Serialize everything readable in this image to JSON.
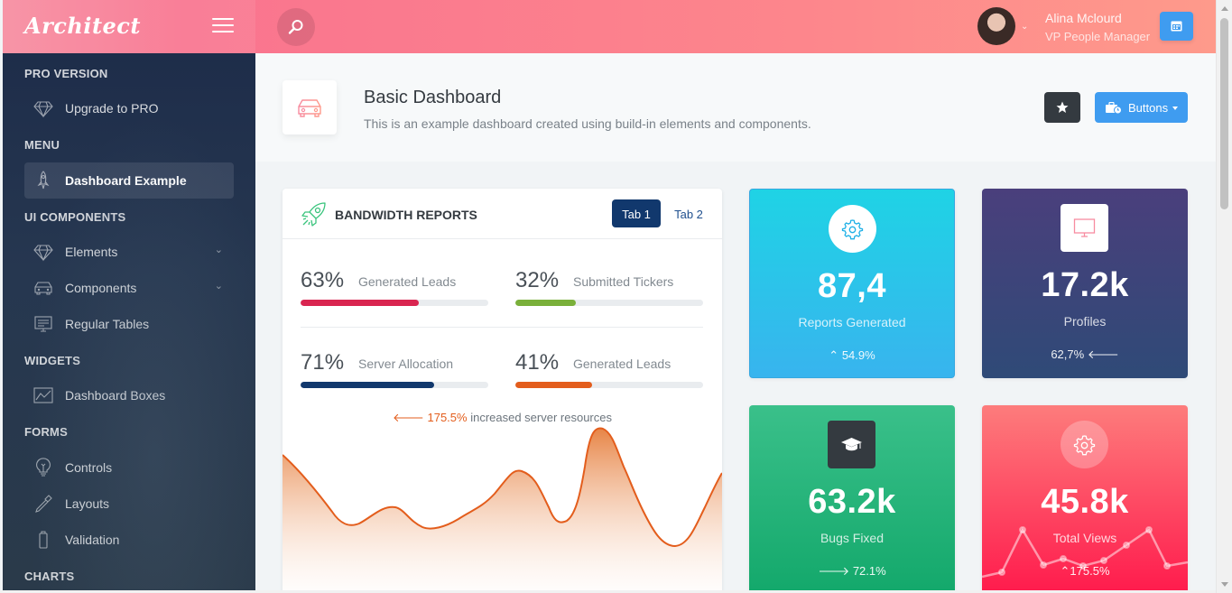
{
  "header": {
    "logo": "Architect",
    "user_name": "Alina Mclourd",
    "user_role": "VP People Manager"
  },
  "sidebar": {
    "sections": [
      {
        "heading": "PRO VERSION",
        "items": [
          {
            "label": "Upgrade to PRO",
            "icon": "diamond-icon"
          }
        ]
      },
      {
        "heading": "MENU",
        "items": [
          {
            "label": "Dashboard Example",
            "icon": "rocket-icon",
            "active": true
          }
        ]
      },
      {
        "heading": "UI COMPONENTS",
        "items": [
          {
            "label": "Elements",
            "icon": "diamond-icon",
            "expandable": true
          },
          {
            "label": "Components",
            "icon": "car-icon",
            "expandable": true
          },
          {
            "label": "Regular Tables",
            "icon": "display-icon"
          }
        ]
      },
      {
        "heading": "WIDGETS",
        "items": [
          {
            "label": "Dashboard Boxes",
            "icon": "graph-icon"
          }
        ]
      },
      {
        "heading": "FORMS",
        "items": [
          {
            "label": "Controls",
            "icon": "light-bulb-icon"
          },
          {
            "label": "Layouts",
            "icon": "eyedropper-icon"
          },
          {
            "label": "Validation",
            "icon": "battery-icon"
          }
        ]
      },
      {
        "heading": "CHARTS",
        "items": []
      }
    ]
  },
  "page_title": {
    "title": "Basic Dashboard",
    "subtitle": "This is an example dashboard created using build-in elements and components.",
    "buttons_label": "Buttons"
  },
  "bandwidth": {
    "title": "BANDWIDTH REPORTS",
    "tabs": [
      "Tab 1",
      "Tab 2"
    ],
    "progress": [
      {
        "pct": "63%",
        "label": "Generated Leads",
        "value": 63,
        "color": "#d92550"
      },
      {
        "pct": "32%",
        "label": "Submitted Tickers",
        "value": 32,
        "color": "#7ab03a"
      },
      {
        "pct": "71%",
        "label": "Server Allocation",
        "value": 71,
        "color": "#11386d"
      },
      {
        "pct": "41%",
        "label": "Generated Leads",
        "value": 41,
        "color": "#e35d1c"
      }
    ],
    "note_value": "175.5%",
    "note_text": "increased server resources"
  },
  "tiles": [
    {
      "value": "87,4",
      "label": "Reports Generated",
      "footer": "54.9%",
      "icon": "gear-icon"
    },
    {
      "value": "17.2k",
      "label": "Profiles",
      "footer": "62,7%",
      "icon": "monitor-icon"
    },
    {
      "value": "63.2k",
      "label": "Bugs Fixed",
      "footer": "72.1%",
      "icon": "graduation-cap-icon"
    },
    {
      "value": "45.8k",
      "label": "Total Views",
      "footer": "175.5%",
      "icon": "gear-icon"
    }
  ],
  "colors": {
    "header_gradient_start": "#f78ca0",
    "header_gradient_end": "#fe9a8b",
    "primary": "#3f9cf0",
    "sidebar": "#1e2d4a",
    "tab_active": "#11386d"
  }
}
